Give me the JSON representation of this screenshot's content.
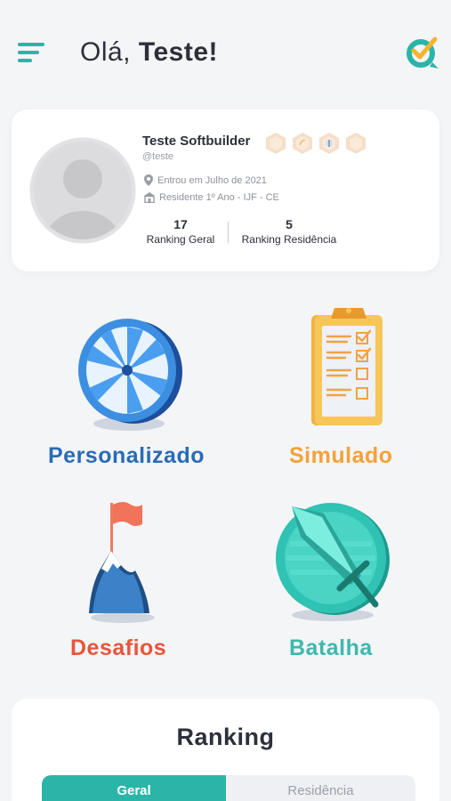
{
  "header": {
    "greeting": "Olá,",
    "user_name": "Teste!"
  },
  "profile": {
    "name": "Teste Softbuilder",
    "handle": "@teste",
    "joined": "Entrou em Julho de 2021",
    "residency": "Residente 1º Ano - IJF - CE",
    "ranking_geral_value": "17",
    "ranking_geral_label": "Ranking Geral",
    "ranking_residencia_value": "5",
    "ranking_residencia_label": "Ranking Residência"
  },
  "modes": {
    "personalizado": "Personalizado",
    "simulado": "Simulado",
    "desafios": "Desafios",
    "batalha": "Batalha"
  },
  "ranking": {
    "title": "Ranking",
    "tabs": [
      "Geral",
      "Residência"
    ]
  },
  "colors": {
    "accent": "#2bb5a8",
    "personalizado": "#2a6bb5",
    "simulado": "#f5a13a",
    "desafios": "#e8553b",
    "batalha": "#3fb8ad"
  },
  "icons": [
    "menu-icon",
    "logo-icon",
    "avatar-icon",
    "location-pin-icon",
    "institution-icon",
    "wheel-icon",
    "clipboard-icon",
    "mountain-flag-icon",
    "sword-icon"
  ]
}
